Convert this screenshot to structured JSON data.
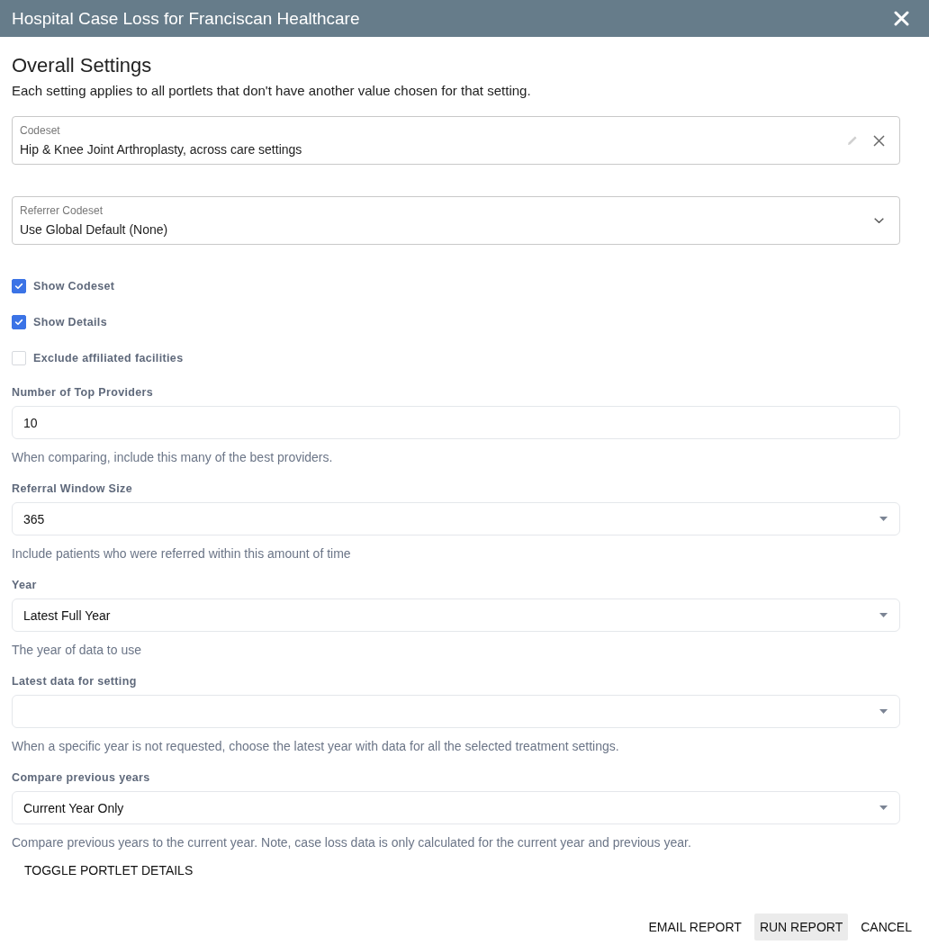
{
  "window": {
    "title": "Hospital Case Loss for Franciscan Healthcare"
  },
  "heading": "Overall Settings",
  "description": "Each setting applies to all portlets that don't have another value chosen for that setting.",
  "fields": [
    {
      "kind": "editable",
      "label": "Codeset",
      "value": "Hip & Knee Joint Arthroplasty, across care settings"
    },
    {
      "kind": "dropdown",
      "label": "Referrer Codeset",
      "value": "Use Global Default (None)"
    }
  ],
  "checkboxes": [
    {
      "label": "Show Codeset",
      "checked": true
    },
    {
      "label": "Show Details",
      "checked": true
    },
    {
      "label": "Exclude affiliated facilities",
      "checked": false
    }
  ],
  "settings": [
    {
      "kind": "input",
      "label": "Number of Top Providers",
      "value": "10",
      "helper": "When comparing, include this many of the best providers."
    },
    {
      "kind": "select",
      "label": "Referral Window Size",
      "value": "365",
      "helper": "Include patients who were referred within this amount of time"
    },
    {
      "kind": "select",
      "label": "Year",
      "value": "Latest Full Year",
      "helper": "The year of data to use"
    },
    {
      "kind": "select",
      "label": "Latest data for setting",
      "helper": "When a specific year is not requested, choose the latest year with data for all the selected treatment settings."
    },
    {
      "kind": "select",
      "label": "Compare previous years",
      "value": "Current Year Only",
      "helper": "Compare previous years to the current year. Note, case loss data is only calculated for the current year and previous year."
    }
  ],
  "toggle_button": "TOGGLE PORTLET DETAILS",
  "actions": [
    {
      "label": "EMAIL REPORT",
      "focused": false
    },
    {
      "label": "RUN REPORT",
      "focused": true
    },
    {
      "label": "CANCEL",
      "focused": false
    }
  ]
}
